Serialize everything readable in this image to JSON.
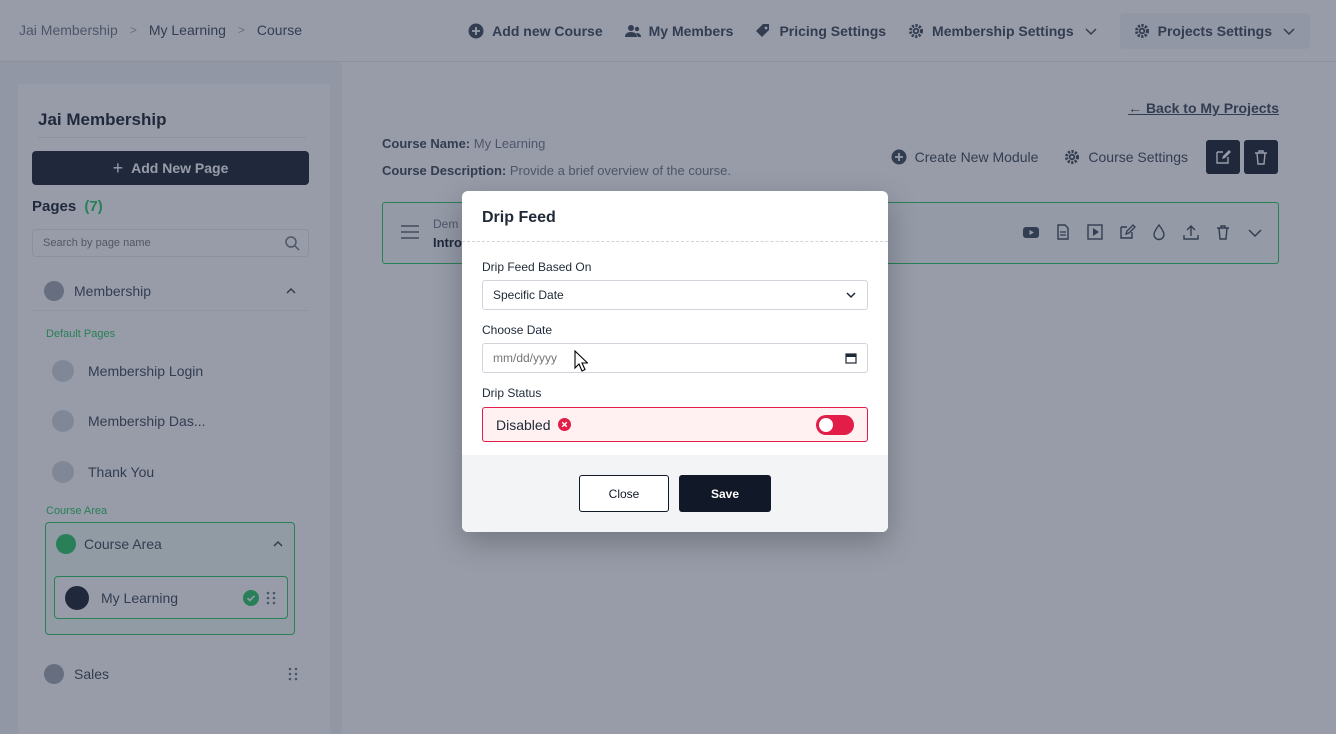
{
  "breadcrumb": [
    "Jai Membership",
    "My Learning",
    "Course"
  ],
  "topnav": {
    "add_course": "Add new Course",
    "members": "My Members",
    "pricing": "Pricing Settings",
    "membership_settings": "Membership Settings",
    "projects_settings": "Projects Settings"
  },
  "sidebar": {
    "title": "Jai Membership",
    "add_page": "Add New Page",
    "pages_label": "Pages",
    "pages_count": "(7)",
    "search_placeholder": "Search by page name",
    "section_membership": "Membership",
    "default_pages_label": "Default Pages",
    "default_pages": [
      "Membership Login",
      "Membership Das...",
      "Thank You"
    ],
    "course_area_label": "Course Area",
    "course_area_title": "Course Area",
    "course_page": "My Learning",
    "section_sales": "Sales"
  },
  "main": {
    "back_link": "Back to My Projects",
    "course_name_label": "Course Name:",
    "course_name_value": "My Learning",
    "course_desc_label": "Course Description:",
    "course_desc_value": "Provide a brief overview of the course.",
    "create_module": "Create New Module",
    "course_settings": "Course Settings",
    "module_line1": "Dem",
    "module_line2": "Intro"
  },
  "modal": {
    "title": "Drip Feed",
    "based_on_label": "Drip Feed Based On",
    "based_on_value": "Specific Date",
    "date_label": "Choose Date",
    "date_placeholder": "mm/dd/yyyy",
    "status_label": "Drip Status",
    "status_value": "Disabled",
    "close": "Close",
    "save": "Save"
  }
}
